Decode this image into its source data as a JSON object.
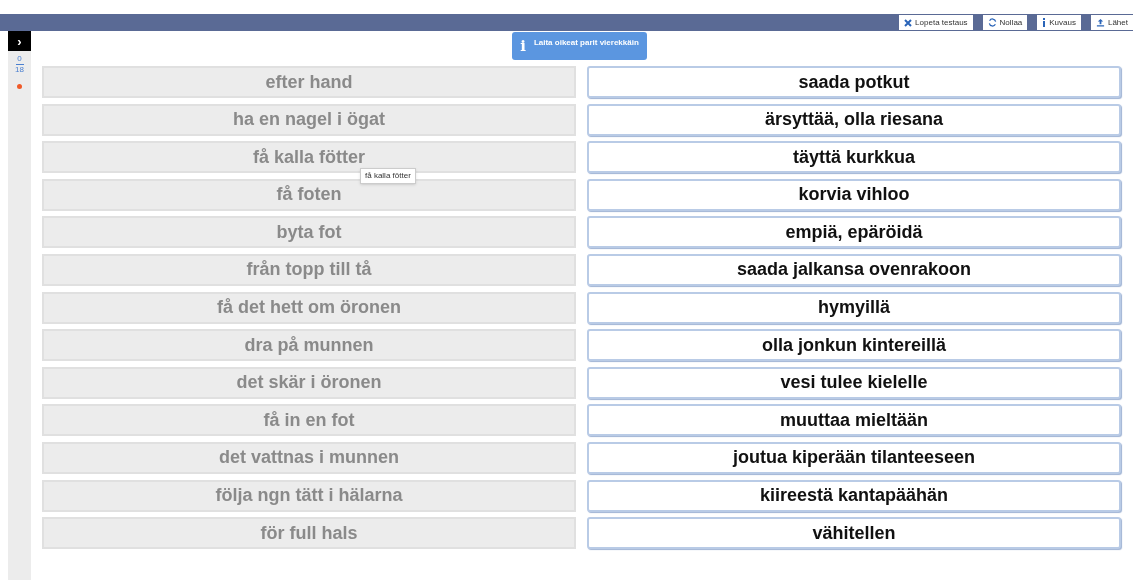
{
  "toolbar": {
    "buttons": [
      {
        "kind": "close",
        "label": "Lopeta testaus"
      },
      {
        "kind": "reset",
        "label": "Nollaa"
      },
      {
        "kind": "info",
        "label": "Kuvaus"
      },
      {
        "kind": "upload",
        "label": "Lähet"
      }
    ]
  },
  "sidebar": {
    "toggle": "›",
    "progress": {
      "done": "0",
      "total": "18"
    }
  },
  "hint": {
    "icon": "i",
    "text": "Laita oikeat parit vierekkäin"
  },
  "left_items": [
    {
      "label": "efter hand"
    },
    {
      "label": "ha en nagel i ögat"
    },
    {
      "label": "få kalla fötter",
      "tooltip": "få kalla fötter"
    },
    {
      "label": "få foten"
    },
    {
      "label": "byta fot"
    },
    {
      "label": "från topp till tå"
    },
    {
      "label": "få det hett om öronen"
    },
    {
      "label": "dra på munnen"
    },
    {
      "label": "det skär i öronen"
    },
    {
      "label": "få in en fot"
    },
    {
      "label": "det vattnas i munnen"
    },
    {
      "label": "följa ngn tätt i hälarna"
    },
    {
      "label": "för full hals"
    }
  ],
  "right_items": [
    "saada potkut",
    "ärsyttää, olla riesana",
    "täyttä kurkkua",
    "korvia vihloo",
    "empiä, epäröidä",
    "saada jalkansa ovenrakoon",
    "hymyillä",
    "olla jonkun kintereillä",
    "vesi tulee kielelle",
    "muuttaa mieltään",
    "joutua kiperään tilanteeseen",
    "kiireestä kantapäähän",
    "vähitellen"
  ]
}
